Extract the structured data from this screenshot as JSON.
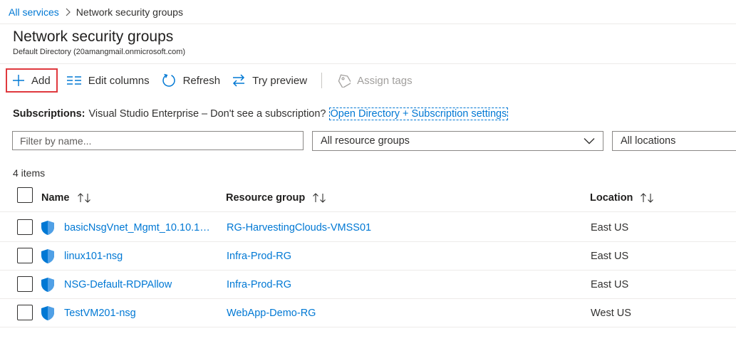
{
  "breadcrumb": {
    "parent": "All services",
    "current": "Network security groups"
  },
  "header": {
    "title": "Network security groups",
    "subtitle": "Default Directory (20amangmail.onmicrosoft.com)"
  },
  "toolbar": {
    "add": "Add",
    "edit_columns": "Edit columns",
    "refresh": "Refresh",
    "try_preview": "Try preview",
    "assign_tags": "Assign tags"
  },
  "subscriptions": {
    "label": "Subscriptions:",
    "value": "Visual Studio Enterprise – Don't see a subscription?",
    "link": "Open Directory + Subscription settings"
  },
  "filters": {
    "name_placeholder": "Filter by name...",
    "resource_groups": "All resource groups",
    "locations": "All locations"
  },
  "count": "4 items",
  "columns": {
    "name": "Name",
    "resource_group": "Resource group",
    "location": "Location"
  },
  "rows": [
    {
      "name": "basicNsgVnet_Mgmt_10.10.1…",
      "resource_group": "RG-HarvestingClouds-VMSS01",
      "location": "East US"
    },
    {
      "name": "linux101-nsg",
      "resource_group": "Infra-Prod-RG",
      "location": "East US"
    },
    {
      "name": "NSG-Default-RDPAllow",
      "resource_group": "Infra-Prod-RG",
      "location": "East US"
    },
    {
      "name": "TestVM201-nsg",
      "resource_group": "WebApp-Demo-RG",
      "location": "West US"
    }
  ],
  "colors": {
    "link": "#0078d4",
    "highlight": "#e0393e",
    "shield": "#0078d4"
  },
  "icons": [
    "chevron-right-icon",
    "plus-icon",
    "edit-columns-icon",
    "refresh-icon",
    "try-preview-icon",
    "tag-icon",
    "chevron-down-icon",
    "sort-icon",
    "shield-icon"
  ]
}
